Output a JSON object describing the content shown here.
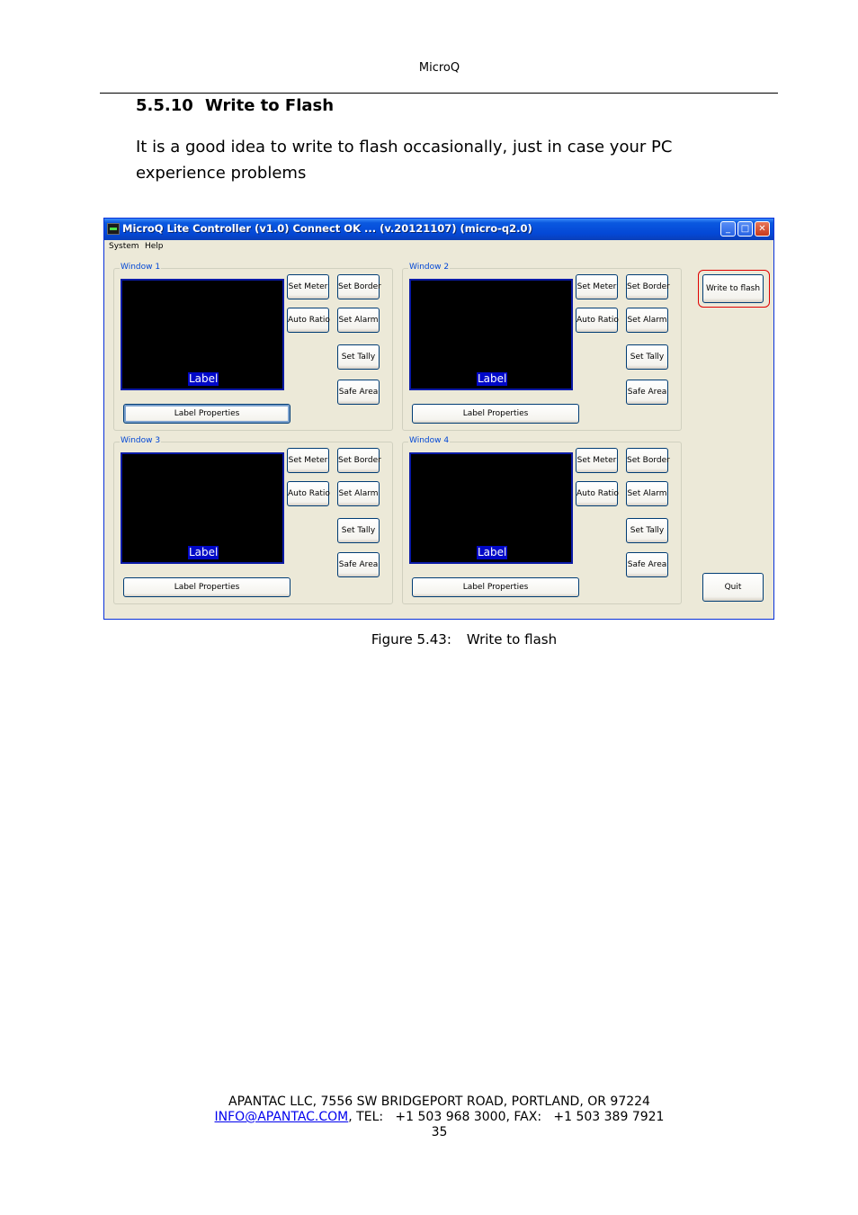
{
  "document": {
    "header": "MicroQ",
    "section": {
      "number": "5.5.10",
      "title": "Write to Flash"
    },
    "intro": "It is a good idea to write to flash occasionally, just in case your PC experience problems",
    "figure_caption": {
      "label": "Figure 5.43:",
      "text": "Write to flash"
    },
    "footer": {
      "address": "APANTAC LLC, 7556 SW BRIDGEPORT ROAD, PORTLAND, OR 97224",
      "email": "INFO@APANTAC.COM",
      "contact": ", TEL:   +1 503 968 3000, FAX:   +1 503 389 7921",
      "page_number": "35"
    }
  },
  "app": {
    "title": "MicroQ Lite Controller (v1.0) Connect OK ... (v.20121107) (micro-q2.0)",
    "caption_buttons": {
      "minimize": "_",
      "maximize": "□",
      "close": "✕"
    },
    "menu": [
      "System",
      "Help"
    ],
    "windows": [
      {
        "name": "Window 1",
        "preview_label": "Label"
      },
      {
        "name": "Window 2",
        "preview_label": "Label"
      },
      {
        "name": "Window 3",
        "preview_label": "Label"
      },
      {
        "name": "Window 4",
        "preview_label": "Label"
      }
    ],
    "window_buttons": {
      "set_meter": "Set Meter",
      "set_border": "Set Border",
      "auto_ratio": "Auto Ratio",
      "set_alarm": "Set Alarm",
      "set_tally": "Set Tally",
      "safe_area": "Safe Area",
      "label_properties": "Label Properties"
    },
    "write_to_flash": "Write to flash",
    "quit": "Quit",
    "colors": {
      "title_bar": "#0448d6",
      "highlight": "#e00000",
      "group_label": "#0046d5",
      "preview_label_bg": "#0008c8"
    }
  }
}
